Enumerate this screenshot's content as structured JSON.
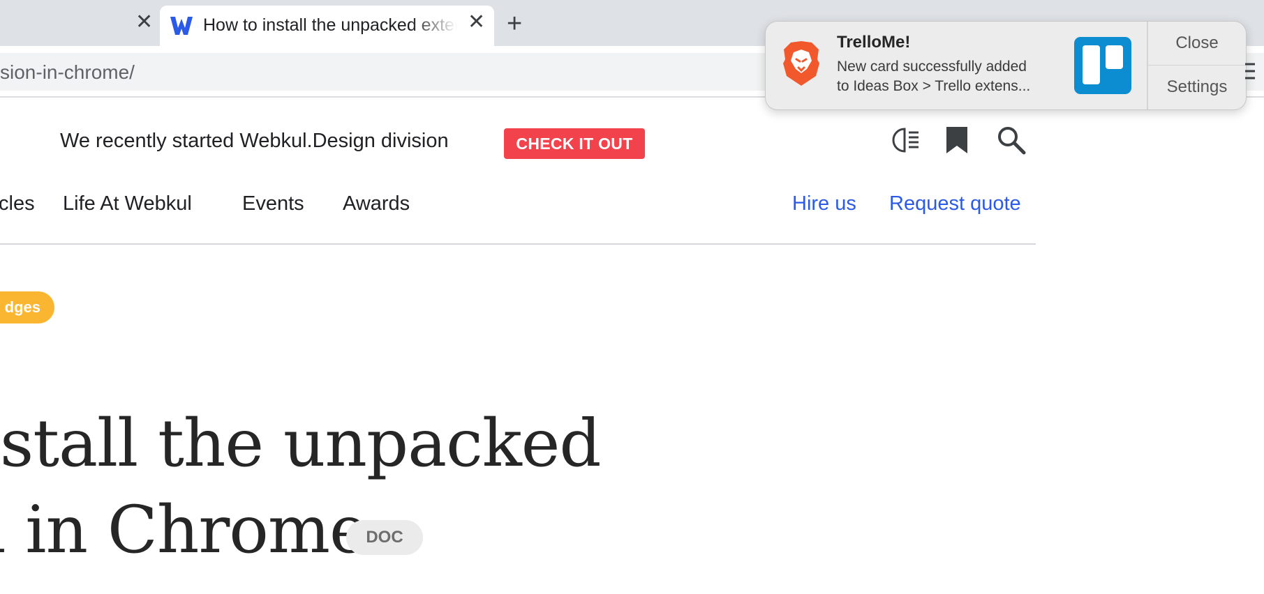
{
  "browser": {
    "tabs": [
      {
        "title": ""
      },
      {
        "title": "How to install the unpacked extension in Chrome"
      }
    ],
    "close_glyph": "✕",
    "new_tab_glyph": "+",
    "url": "sion-in-chrome/"
  },
  "site": {
    "announcement": {
      "text": "We recently started Webkul.Design division",
      "button": "CHECK IT OUT"
    },
    "header_icons": [
      "reader-mode-icon",
      "bookmark-icon",
      "search-icon"
    ],
    "nav": {
      "items": [
        "cles",
        "Life At Webkul",
        "Events",
        "Awards"
      ],
      "cta": [
        "Hire us",
        "Request quote"
      ]
    },
    "category": "dges",
    "heading": {
      "line1": "stall the unpacked",
      "line2": "n in Chrome",
      "badge": "DOC"
    }
  },
  "notification": {
    "title": "TrelloMe!",
    "line1": "New card successfully added",
    "line2": "to Ideas Box > Trello extens...",
    "buttons": [
      "Close",
      "Settings"
    ]
  },
  "colors": {
    "check_it_out_bg": "#f2434d",
    "nav_link_blue": "#2b59e8",
    "category_pill": "#fbb631",
    "trello_blue": "#0c8cd1",
    "brave_orange": "#f1582b"
  }
}
